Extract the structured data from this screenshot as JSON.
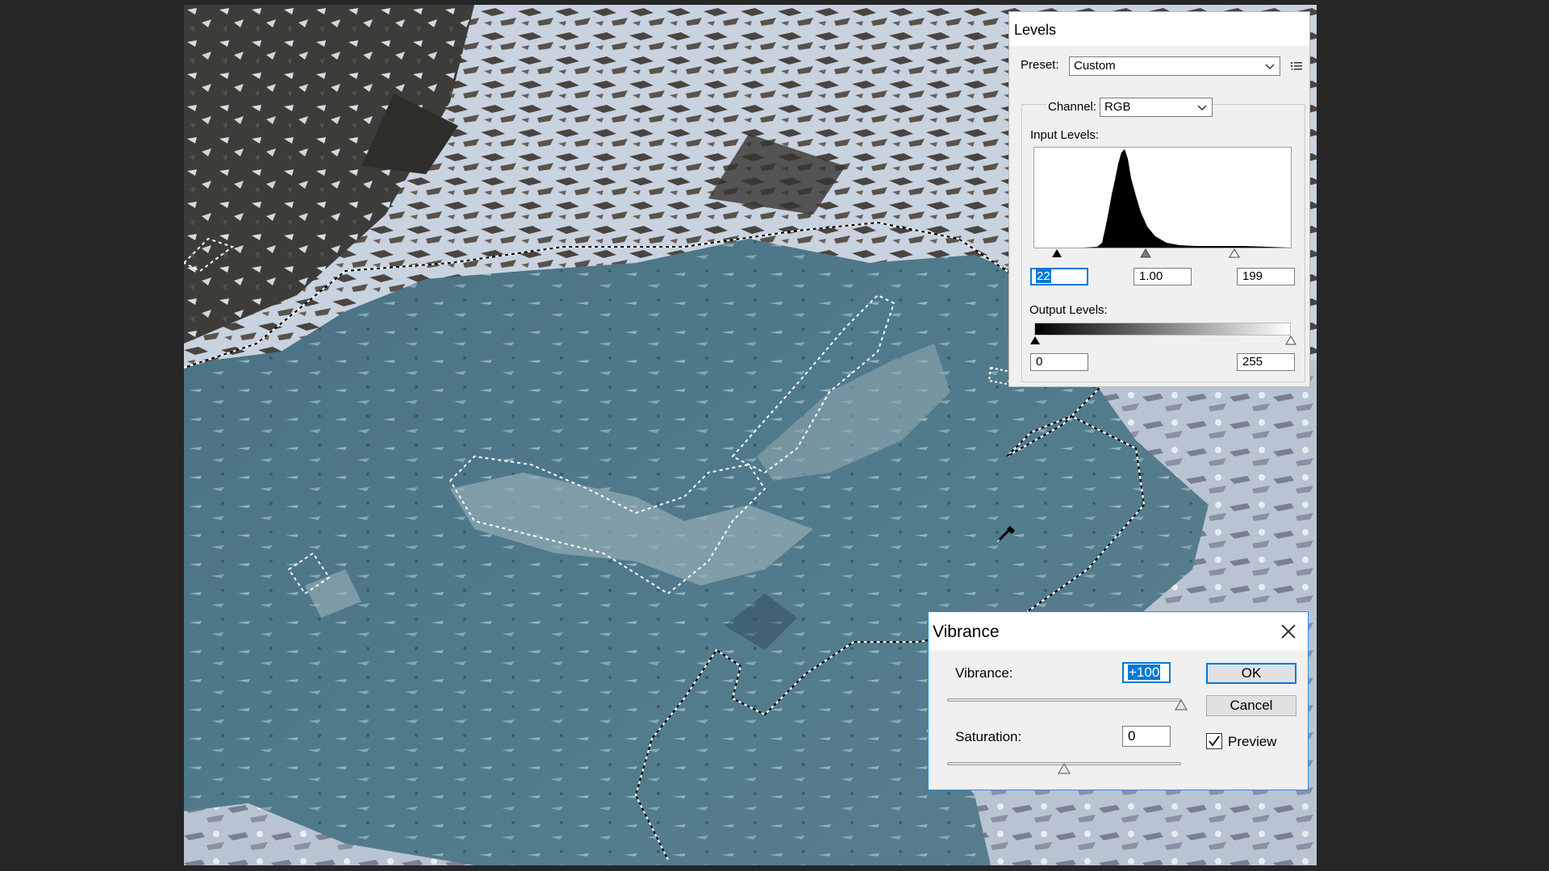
{
  "levels": {
    "title": "Levels",
    "preset_label": "Preset:",
    "preset_value": "Custom",
    "channel_label": "Channel:",
    "channel_value": "RGB",
    "input_levels_label": "Input Levels:",
    "input_black": "22",
    "input_gamma": "1.00",
    "input_white": "199",
    "output_levels_label": "Output Levels:",
    "output_black": "0",
    "output_white": "255",
    "preset_options_icon": "menu-options-icon"
  },
  "vibrance": {
    "title": "Vibrance",
    "vibrance_label": "Vibrance:",
    "vibrance_value": "+100",
    "vibrance_level": 100,
    "saturation_label": "Saturation:",
    "saturation_value": "0",
    "saturation_level": 0,
    "ok_label": "OK",
    "cancel_label": "Cancel",
    "preview_label": "Preview",
    "preview_checked": true
  },
  "colors": {
    "dialog_bg": "#f0f0f0",
    "accent": "#0078d7",
    "app_bg": "#262626",
    "water": "#4f7889",
    "snow": "#d8e0ea"
  }
}
